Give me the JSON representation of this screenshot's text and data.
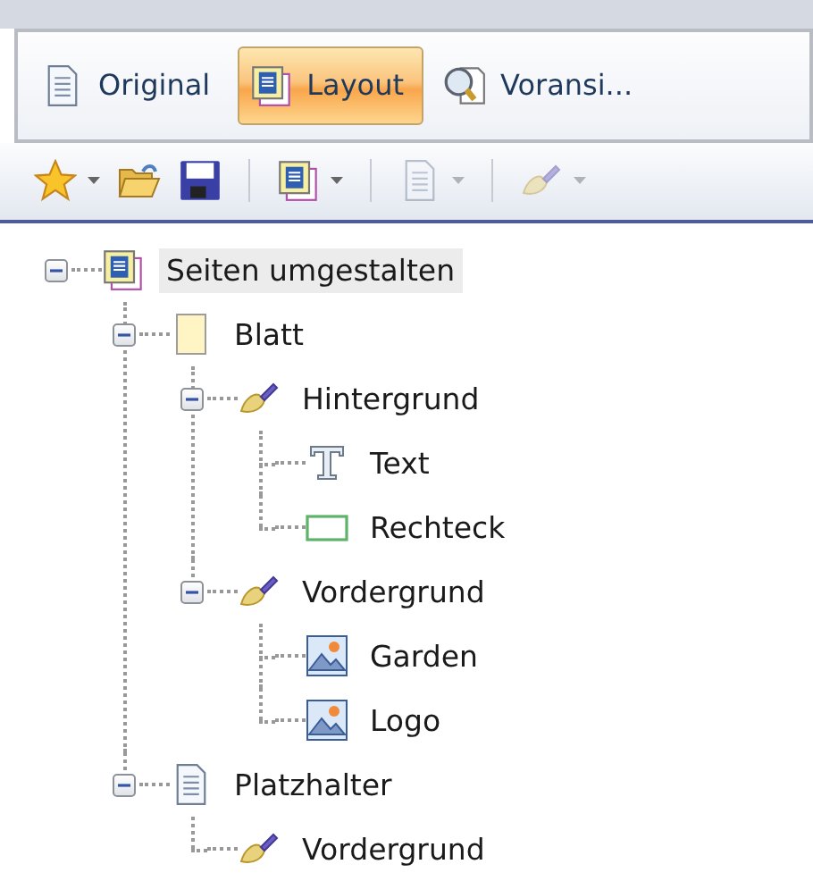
{
  "view_tabs": [
    {
      "label": "Original",
      "selected": false
    },
    {
      "label": "Layout",
      "selected": true
    },
    {
      "label": "Voransi...",
      "selected": false
    }
  ],
  "toolbar": [
    {
      "kind": "button",
      "dropdown": true,
      "disabled": false
    },
    {
      "kind": "button",
      "dropdown": false,
      "disabled": false
    },
    {
      "kind": "button",
      "dropdown": false,
      "disabled": false
    },
    {
      "kind": "separator"
    },
    {
      "kind": "button",
      "dropdown": true,
      "disabled": false
    },
    {
      "kind": "separator"
    },
    {
      "kind": "button",
      "dropdown": true,
      "disabled": true
    },
    {
      "kind": "separator"
    },
    {
      "kind": "button",
      "dropdown": true,
      "disabled": true
    }
  ],
  "tree": [
    {
      "label": "Seiten umgestalten",
      "kind": "layout",
      "selected": true,
      "expanded": true,
      "children": [
        {
          "label": "Blatt",
          "kind": "sheet",
          "selected": false,
          "expanded": true,
          "children": [
            {
              "label": "Hintergrund",
              "kind": "brush",
              "selected": false,
              "expanded": true,
              "children": [
                {
                  "label": "Text",
                  "kind": "text",
                  "selected": false
                },
                {
                  "label": "Rechteck",
                  "kind": "rect",
                  "selected": false
                }
              ]
            },
            {
              "label": "Vordergrund",
              "kind": "brush",
              "selected": false,
              "expanded": true,
              "children": [
                {
                  "label": "Garden",
                  "kind": "image",
                  "selected": false
                },
                {
                  "label": "Logo",
                  "kind": "image",
                  "selected": false
                }
              ]
            }
          ]
        },
        {
          "label": "Platzhalter",
          "kind": "page",
          "selected": false,
          "expanded": true,
          "children": [
            {
              "label": "Vordergrund",
              "kind": "brush",
              "selected": false
            }
          ]
        }
      ]
    }
  ]
}
